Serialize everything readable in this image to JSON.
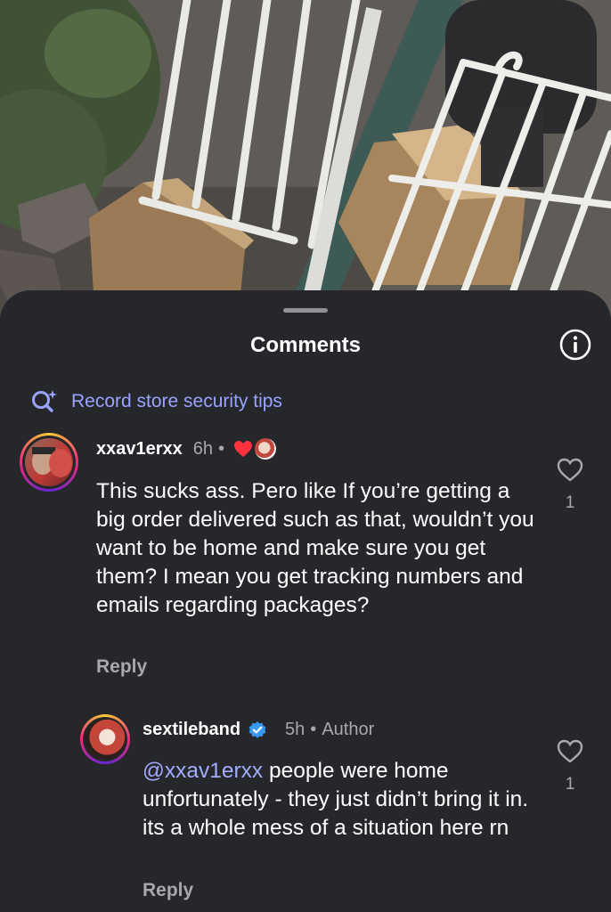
{
  "sheet": {
    "title": "Comments",
    "search_suggestion": "Record store security tips"
  },
  "comments": [
    {
      "username": "xxav1erxx",
      "time": "6h",
      "body": "This sucks ass. Pero like If you’re getting a big order delivered such as that, wouldn’t you want to be home and make sure you get them? I mean you get tracking numbers and emails regarding packages?",
      "reply_label": "Reply",
      "like_count": "1"
    },
    {
      "username": "sextileband",
      "time": "5h",
      "author_badge": "Author",
      "mention": "@xxav1erxx",
      "body": " people were home unfortunately - they just didn’t bring it in. its a whole mess of a situation here rn",
      "reply_label": "Reply",
      "like_count": "1"
    }
  ],
  "colors": {
    "sheet_bg": "#25272b",
    "accent_link": "#a3acff",
    "verified": "#3897f0",
    "like_heart": "#ff3040"
  }
}
